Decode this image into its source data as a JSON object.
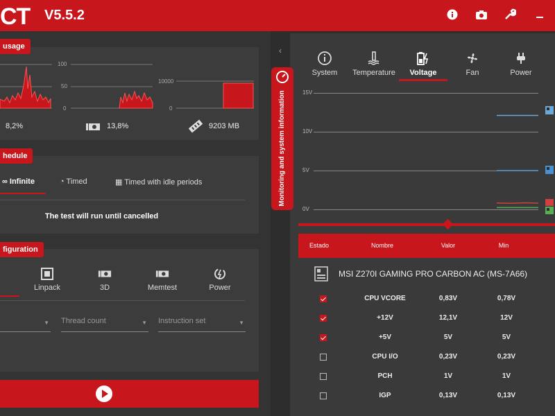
{
  "app": {
    "logo_text": "CT",
    "version": "V5.5.2"
  },
  "toolbar": {
    "icons": [
      "info-icon",
      "camera-icon",
      "wrench-icon",
      "minimize-icon"
    ]
  },
  "usage_panel": {
    "title": "usage",
    "cpu_axis": "",
    "gpu_axis_labels": [
      "100",
      "50",
      "0"
    ],
    "mem_axis_labels": [
      "10000",
      "0"
    ],
    "cpu_percent": "8,2%",
    "gpu_percent": "13,8%",
    "memory": "9203 MB"
  },
  "schedule_panel": {
    "title": "hedule",
    "modes": [
      "Infinite",
      "Timed",
      "Timed with idle periods"
    ],
    "active_mode": "Infinite",
    "hint": "The test will run until cancelled"
  },
  "config_panel": {
    "title": "figuration",
    "items": [
      "Linpack",
      "3D",
      "Memtest",
      "Power"
    ],
    "dropdowns": [
      "Thread count",
      "Instruction set"
    ]
  },
  "monitor": {
    "side_tab_label": "Monitoring and system information",
    "tabs": [
      "System",
      "Temperature",
      "Voltage",
      "Fan",
      "Power"
    ],
    "active_tab": "Voltage",
    "chart_data": {
      "type": "line",
      "title": "",
      "ylim": [
        0,
        15
      ],
      "y_ticks": [
        "15V",
        "10V",
        "5V",
        "0V"
      ],
      "series": [
        {
          "values": [
            12.1,
            12.1,
            12.1,
            12.1
          ],
          "color": "#6aa9d8"
        },
        {
          "values": [
            5.0,
            5.0,
            5.0,
            5.0
          ],
          "color": "#4a8fd0"
        },
        {
          "values": [
            0.83,
            0.78,
            0.85,
            0.8
          ],
          "color": "#d04040"
        },
        {
          "values": [
            0.23,
            0.23,
            0.23,
            0.23
          ],
          "color": "#55b055"
        }
      ]
    },
    "table": {
      "headers": [
        "Estado",
        "Nombre",
        "Valor",
        "Min"
      ],
      "device": "MSI Z270I GAMING PRO CARBON AC (MS-7A66)",
      "rows": [
        {
          "checked": true,
          "name": "CPU VCORE",
          "value": "0,83V",
          "min": "0,78V"
        },
        {
          "checked": true,
          "name": "+12V",
          "value": "12,1V",
          "min": "12V"
        },
        {
          "checked": true,
          "name": "+5V",
          "value": "5V",
          "min": "5V"
        },
        {
          "checked": false,
          "name": "CPU I/O",
          "value": "0,23V",
          "min": "0,23V"
        },
        {
          "checked": false,
          "name": "PCH",
          "value": "1V",
          "min": "1V"
        },
        {
          "checked": false,
          "name": "IGP",
          "value": "0,13V",
          "min": "0,13V"
        }
      ]
    }
  }
}
